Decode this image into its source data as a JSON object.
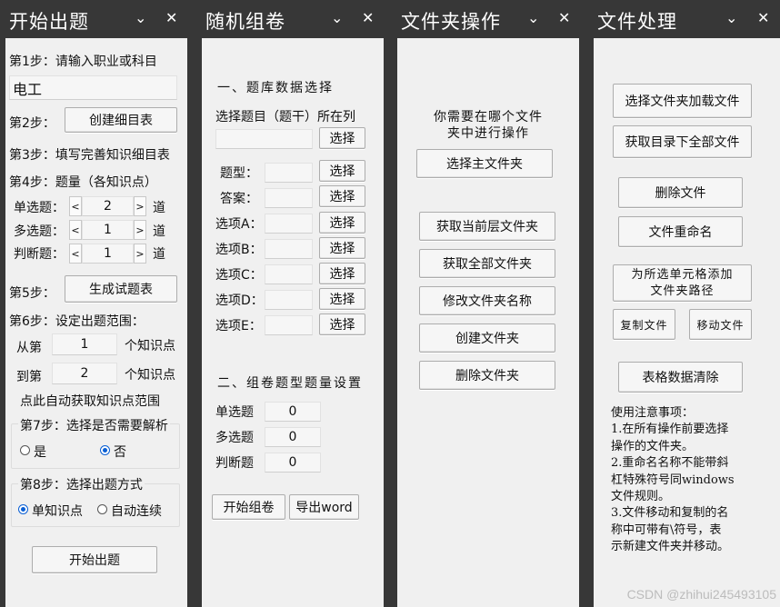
{
  "panes": {
    "p1": {
      "title": "开始出题",
      "step1": "第1步：请输入职业或科目",
      "subject_value": "电工",
      "step2": "第2步：",
      "create_button": "创建细目表",
      "step3": "第3步：填写完善知识细目表",
      "step4": "第4步：题量（各知识点）",
      "single_label": "单选题：",
      "single_value": "2",
      "multi_label": "多选题：",
      "multi_value": "1",
      "judge_label": "判断题：",
      "judge_value": "1",
      "unit": "道",
      "step5": "第5步：",
      "generate_button": "生成试题表",
      "step6": "第6步：设定出题范围：",
      "from_label": "从第",
      "from_value": "1",
      "from_suffix": "个知识点",
      "to_label": "到第",
      "to_value": "2",
      "to_suffix": "个知识点",
      "auto_range": "点此自动获取知识点范围",
      "step7": "第7步：选择是否需要解析",
      "opt_yes": "是",
      "opt_no": "否",
      "step8": "第8步：选择出题方式",
      "opt_single": "单知识点",
      "opt_auto": "自动连续",
      "start_button": "开始出题"
    },
    "p2": {
      "title": "随机组卷",
      "section1": "一、题库数据选择",
      "select_column_label": "选择题目（题干）所在列",
      "select_label": "选择",
      "fields": [
        "题型：",
        "答案：",
        "选项A：",
        "选项B：",
        "选项C：",
        "选项D：",
        "选项E："
      ],
      "section2": "二、组卷题型题量设置",
      "counts": [
        {
          "label": "单选题",
          "value": "0"
        },
        {
          "label": "多选题",
          "value": "0"
        },
        {
          "label": "判断题",
          "value": "0"
        }
      ],
      "start_button": "开始组卷",
      "export_button": "导出word"
    },
    "p3": {
      "title": "文件夹操作",
      "prompt": [
        "你需要在哪个文件",
        "夹中进行操作"
      ],
      "buttons": [
        "选择主文件夹",
        "获取当前层文件夹",
        "获取全部文件夹",
        "修改文件夹名称",
        "创建文件夹",
        "删除文件夹"
      ]
    },
    "p4": {
      "title": "文件处理",
      "btn_load": "选择文件夹加载文件",
      "btn_getall": "获取目录下全部文件",
      "btn_delete": "删除文件",
      "btn_rename": "文件重命名",
      "btn_addpath": [
        "为所选单元格添加",
        "文件夹路径"
      ],
      "btn_copy": "复制文件",
      "btn_move": "移动文件",
      "btn_clear": "表格数据清除",
      "notes": [
        "使用注意事项：",
        "1.在所有操作前要选择",
        "操作的文件夹。",
        "2.重命名名称不能带斜",
        "杠特殊符号同windows",
        "文件规则。",
        "3.文件移动和复制的名",
        "称中可带有\\符号，表",
        "示新建文件夹并移动。"
      ]
    }
  },
  "watermark": "CSDN @zhihui245493105"
}
